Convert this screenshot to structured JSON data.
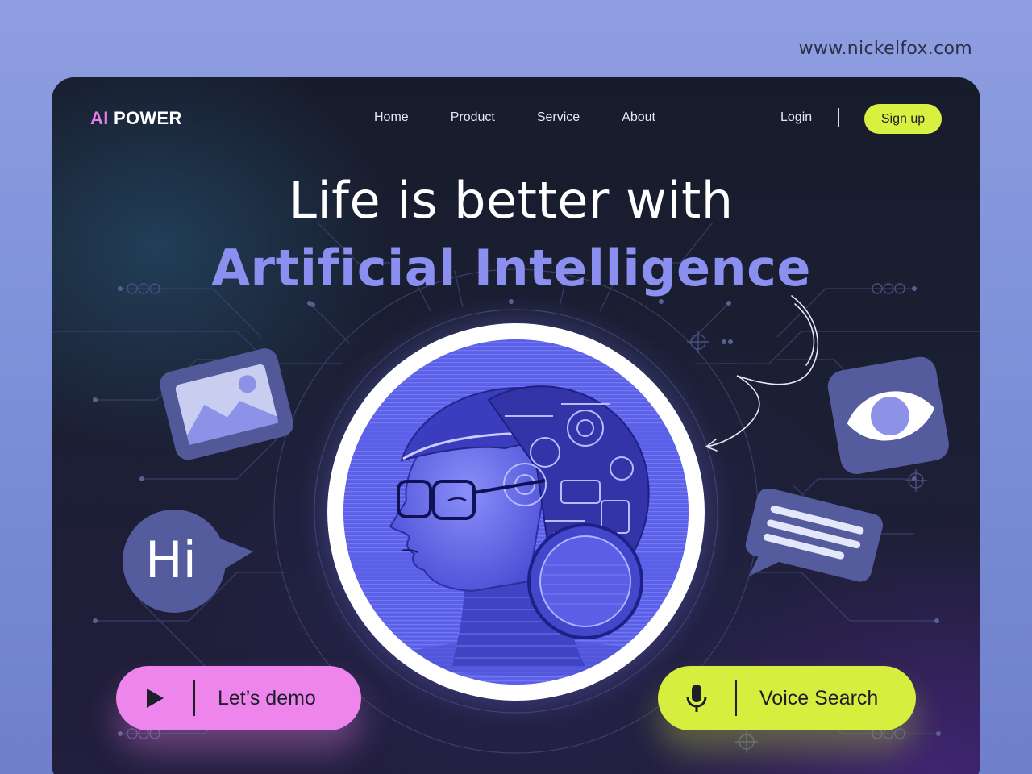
{
  "site_url": "www.nickelfox.com",
  "nav": {
    "logo_accent": "AI",
    "logo_rest": "POWER",
    "links": [
      "Home",
      "Product",
      "Service",
      "About"
    ],
    "login": "Login",
    "signup": "Sign up"
  },
  "hero": {
    "headline_line1": "Life is better with",
    "headline_line2": "Artificial Intelligence"
  },
  "floating": {
    "chat_hi": "Hi"
  },
  "cta": {
    "demo_label": "Let’s demo",
    "voice_label": "Voice Search"
  },
  "colors": {
    "page_bg": "#8f9ee0",
    "frame_bg": "#171c2c",
    "logo_accent": "#e57ce8",
    "headline_accent": "#8b8ff0",
    "signup_bg": "#d8f03f",
    "demo_bg": "#ee85ec",
    "voice_bg": "#d6ef3e",
    "portrait_blue": "#5b60e8"
  },
  "icons": [
    "image-icon",
    "chat-hi-icon",
    "eye-icon",
    "message-lines-icon",
    "play-icon",
    "microphone-icon",
    "arrow-doodle-icon"
  ]
}
